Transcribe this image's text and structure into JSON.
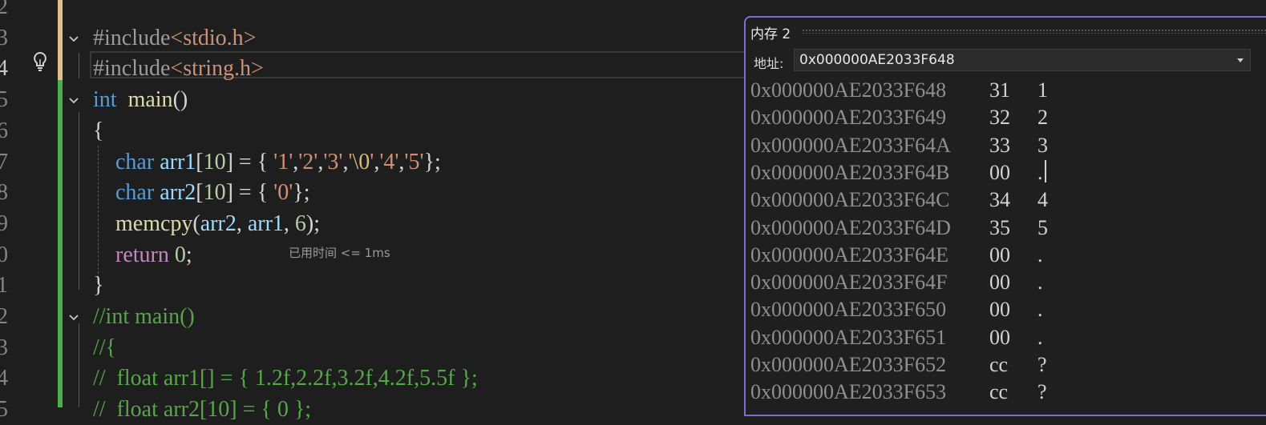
{
  "editor": {
    "line_numbers": [
      "2",
      "3",
      "4",
      "5",
      "6",
      "7",
      "8",
      "9",
      "0",
      "1",
      "2",
      "3",
      "4",
      "5"
    ],
    "elapsed_hint": "已用时间 <= 1ms",
    "lines": [
      {
        "tokens": [
          [
            "pp",
            "#include"
          ],
          [
            "inc",
            "<stdio.h>"
          ]
        ]
      },
      {
        "tokens": [
          [
            "pp",
            "#include"
          ],
          [
            "inc",
            "<string.h>"
          ]
        ]
      },
      {
        "tokens": [
          [
            "kw",
            "int"
          ],
          [
            "",
            "  "
          ],
          [
            "fn",
            "main"
          ],
          [
            "",
            "()"
          ]
        ]
      },
      {
        "tokens": [
          [
            "",
            "{"
          ]
        ]
      },
      {
        "tokens": [
          [
            "",
            "    "
          ],
          [
            "kw",
            "char"
          ],
          [
            "",
            " "
          ],
          [
            "var",
            "arr1"
          ],
          [
            "",
            "["
          ],
          [
            "num",
            "10"
          ],
          [
            "",
            "] = { "
          ],
          [
            "str",
            "'1'"
          ],
          [
            "",
            ","
          ],
          [
            "str",
            "'2'"
          ],
          [
            "",
            ","
          ],
          [
            "str",
            "'3'"
          ],
          [
            "",
            ","
          ],
          [
            "str",
            "'"
          ],
          [
            "esc",
            "\\0"
          ],
          [
            "str",
            "'"
          ],
          [
            "",
            ","
          ],
          [
            "str",
            "'4'"
          ],
          [
            "",
            ","
          ],
          [
            "str",
            "'5'"
          ],
          [
            "",
            "};"
          ]
        ]
      },
      {
        "tokens": [
          [
            "",
            "    "
          ],
          [
            "kw",
            "char"
          ],
          [
            "",
            " "
          ],
          [
            "var",
            "arr2"
          ],
          [
            "",
            "["
          ],
          [
            "num",
            "10"
          ],
          [
            "",
            "] = { "
          ],
          [
            "str",
            "'0'"
          ],
          [
            "",
            "};"
          ]
        ]
      },
      {
        "tokens": [
          [
            "",
            "    "
          ],
          [
            "fn",
            "memcpy"
          ],
          [
            "",
            "("
          ],
          [
            "var",
            "arr2"
          ],
          [
            "",
            ", "
          ],
          [
            "var",
            "arr1"
          ],
          [
            "",
            ", "
          ],
          [
            "num",
            "6"
          ],
          [
            "",
            ");"
          ]
        ]
      },
      {
        "tokens": [
          [
            "",
            "    "
          ],
          [
            "ctl",
            "return"
          ],
          [
            "",
            " "
          ],
          [
            "num",
            "0"
          ],
          [
            "",
            ";"
          ]
        ]
      },
      {
        "tokens": [
          [
            "",
            "}"
          ]
        ]
      },
      {
        "tokens": [
          [
            "cmt",
            "//int main()"
          ]
        ]
      },
      {
        "tokens": [
          [
            "cmt",
            "//{"
          ]
        ]
      },
      {
        "tokens": [
          [
            "cmt",
            "//  float arr1[] = { 1.2f,2.2f,3.2f,4.2f,5.5f };"
          ]
        ]
      },
      {
        "tokens": [
          [
            "cmt",
            "//  float arr2[10] = { 0 };"
          ]
        ]
      }
    ]
  },
  "memory_window": {
    "title": "内存 2",
    "address_label": "地址:",
    "address_value": "0x000000AE2033F648",
    "rows": [
      {
        "addr": "0x000000AE2033F648",
        "hex": "31",
        "chr": "1"
      },
      {
        "addr": "0x000000AE2033F649",
        "hex": "32",
        "chr": "2"
      },
      {
        "addr": "0x000000AE2033F64A",
        "hex": "33",
        "chr": "3"
      },
      {
        "addr": "0x000000AE2033F64B",
        "hex": "00",
        "chr": "."
      },
      {
        "addr": "0x000000AE2033F64C",
        "hex": "34",
        "chr": "4"
      },
      {
        "addr": "0x000000AE2033F64D",
        "hex": "35",
        "chr": "5"
      },
      {
        "addr": "0x000000AE2033F64E",
        "hex": "00",
        "chr": "."
      },
      {
        "addr": "0x000000AE2033F64F",
        "hex": "00",
        "chr": "."
      },
      {
        "addr": "0x000000AE2033F650",
        "hex": "00",
        "chr": "."
      },
      {
        "addr": "0x000000AE2033F651",
        "hex": "00",
        "chr": "."
      },
      {
        "addr": "0x000000AE2033F652",
        "hex": "cc",
        "chr": "?"
      },
      {
        "addr": "0x000000AE2033F653",
        "hex": "cc",
        "chr": "?"
      }
    ]
  },
  "colors": {
    "background": "#1e1e1e",
    "memory_border": "#7a6fd0",
    "changed_lines_bar": "#4cae4c",
    "unsaved_lines_bar": "#e2c08d"
  }
}
